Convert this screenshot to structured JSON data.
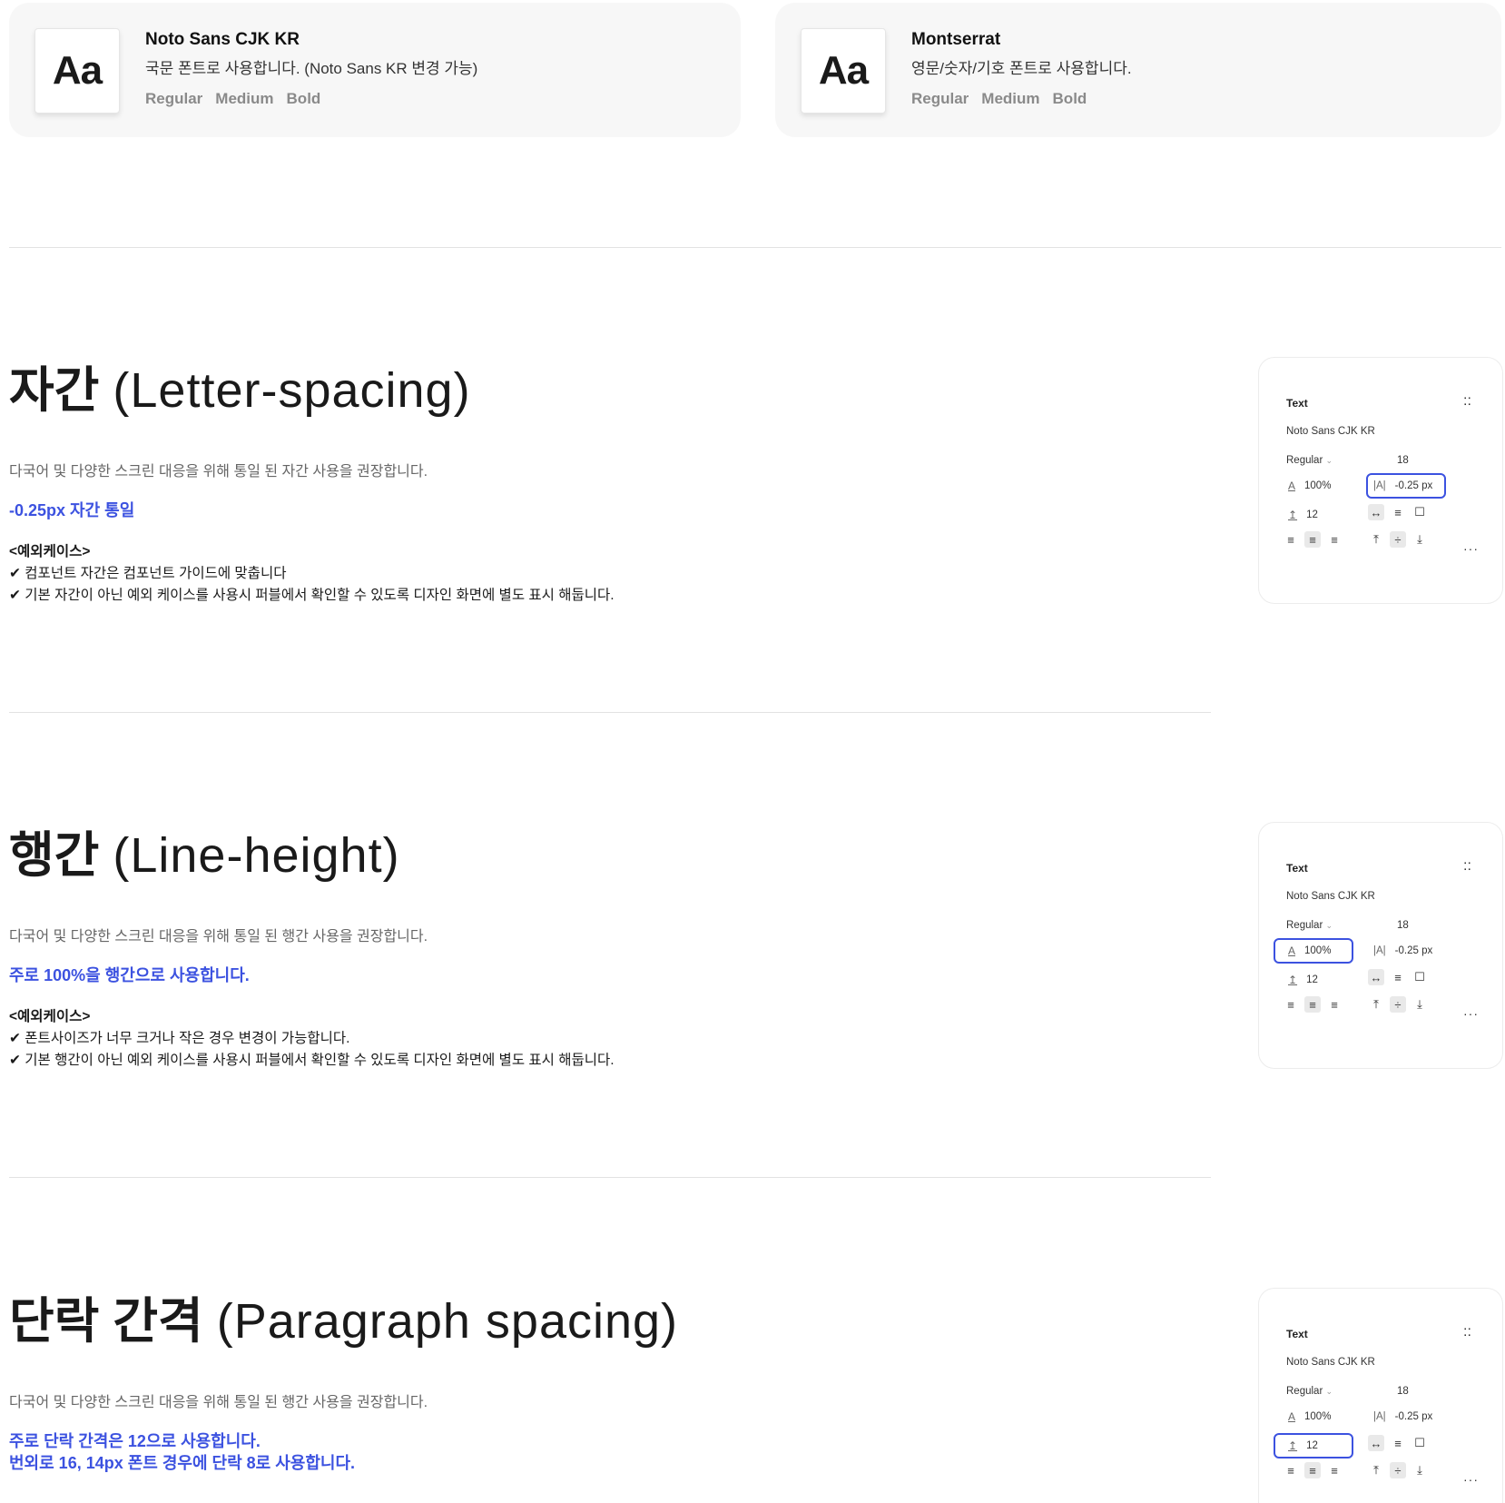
{
  "font_cards": [
    {
      "sample": "Aa",
      "name": "Noto Sans CJK KR",
      "description": "국문 폰트로 사용합니다. (Noto Sans KR 변경 가능)",
      "weights": [
        "Regular",
        "Medium",
        "Bold"
      ]
    },
    {
      "sample": "Aa",
      "name": "Montserrat",
      "description": "영문/숫자/기호 폰트로 사용합니다.",
      "weights": [
        "Regular",
        "Medium",
        "Bold"
      ]
    }
  ],
  "sections": [
    {
      "title_ko": "자간",
      "title_en": "(Letter-spacing)",
      "description": "다국어 및 다양한 스크린 대응을 위해 통일 된 자간 사용을 권장합니다.",
      "rules": [
        "-0.25px 자간 통일"
      ],
      "exceptions_title": "<예외케이스>",
      "exceptions": [
        "✔ 컴포넌트 자간은 컴포넌트 가이드에 맞춥니다",
        "✔ 기본 자간이 아닌 예외 케이스를 사용시 퍼블에서 확인할 수 있도록 디자인 화면에 별도 표시 해둡니다."
      ]
    },
    {
      "title_ko": "행간",
      "title_en": "(Line-height)",
      "description": "다국어 및 다양한 스크린 대응을 위해 통일 된 행간 사용을 권장합니다.",
      "rules": [
        "주로 100%을 행간으로 사용합니다."
      ],
      "exceptions_title": "<예외케이스>",
      "exceptions": [
        "✔ 폰트사이즈가 너무 크거나 작은 경우 변경이 가능합니다.",
        "✔ 기본 행간이 아닌 예외 케이스를 사용시 퍼블에서 확인할 수 있도록 디자인 화면에 별도 표시 해둡니다."
      ]
    },
    {
      "title_ko": "단락 간격",
      "title_en": "(Paragraph spacing)",
      "description": "다국어 및 다양한 스크린 대응을 위해 통일 된 행간 사용을 권장합니다.",
      "rules": [
        "주로 단락 간격은 12으로 사용합니다.",
        "번외로 16, 14px 폰트 경우에 단락 8로 사용합니다."
      ]
    }
  ],
  "panel": {
    "title": "Text",
    "font": "Noto Sans CJK KR",
    "weight": "Regular",
    "size": "18",
    "line_height": "100%",
    "letter_spacing": "-0.25 px",
    "paragraph_spacing": "12",
    "dots_icon": "::",
    "more_icon": "···"
  },
  "colors": {
    "accent": "#3c52e0",
    "card_bg": "#f7f7f7",
    "muted_text": "#8a8a8a"
  }
}
